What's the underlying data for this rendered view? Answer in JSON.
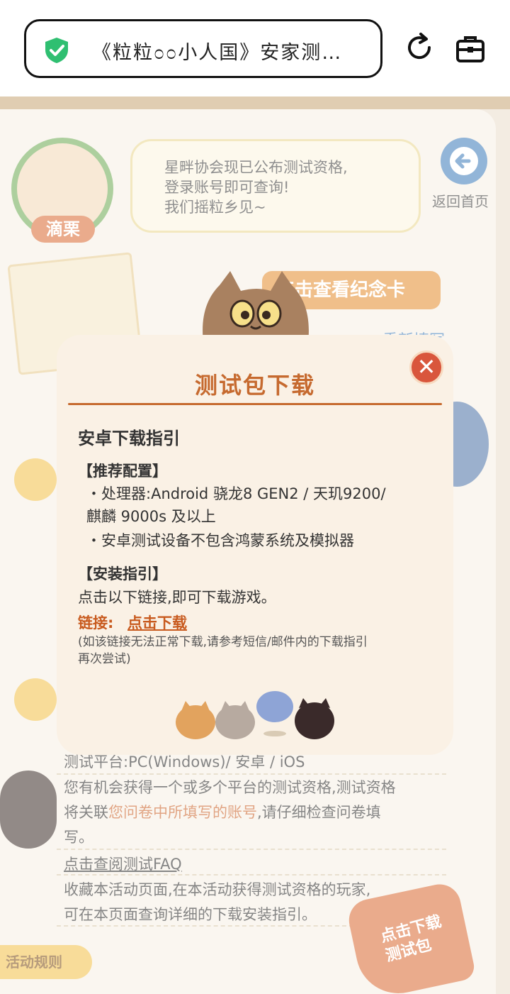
{
  "browser": {
    "url_title": "《粒粒೦೦小人国》安家测…",
    "secure_icon": "shield-check-icon",
    "reload_icon": "reload-icon",
    "toolbox_icon": "toolbox-icon"
  },
  "background": {
    "avatar_name": "滴栗",
    "speech": [
      "星畔协会现已公布测试资格,",
      "登录账号即可查询!",
      "我们摇粒乡见~"
    ],
    "home_label": "返回首页",
    "memorial_card_button": "点击查看纪念卡",
    "refill_link": "重新填写",
    "rules": {
      "platform_line": "测试平台:PC(Windows)/ 安卓 / iOS",
      "qualify_line_1": "您有机会获得一个或多个平台的测试资格,测试资格",
      "qualify_line_2_pre": "将关联",
      "qualify_line_2_hl": "您问卷中所填写的账号",
      "qualify_line_2_post": ",请仔细检查问卷填",
      "qualify_line_3": "写。",
      "faq_link": "点击查阅测试FAQ",
      "bookmark_line_1": "收藏本活动页面,在本活动获得测试资格的玩家,",
      "bookmark_line_2": "可在本页面查询详细的下载安装指引。"
    },
    "rules_tab": "活动规则",
    "download_stamp": [
      "点击下载",
      "测试包"
    ]
  },
  "modal": {
    "title": "测试包下载",
    "close_icon": "close-icon",
    "section_heading": "安卓下载指引",
    "recommended_heading": "【推荐配置】",
    "processor_line_1": "・处理器:Android 骁龙8 GEN2 / 天玑9200/",
    "processor_line_2": "麒麟 9000s 及以上",
    "device_line": "・安卓测试设备不包含鸿蒙系统及模拟器",
    "install_heading": "【安装指引】",
    "install_text": "点击以下链接,即可下载游戏。",
    "link_label": "链接:",
    "link_text": "点击下载",
    "note_line_1": "(如该链接无法正常下载,请参考短信/邮件内的下载指引",
    "note_line_2": "再次尝试)"
  }
}
